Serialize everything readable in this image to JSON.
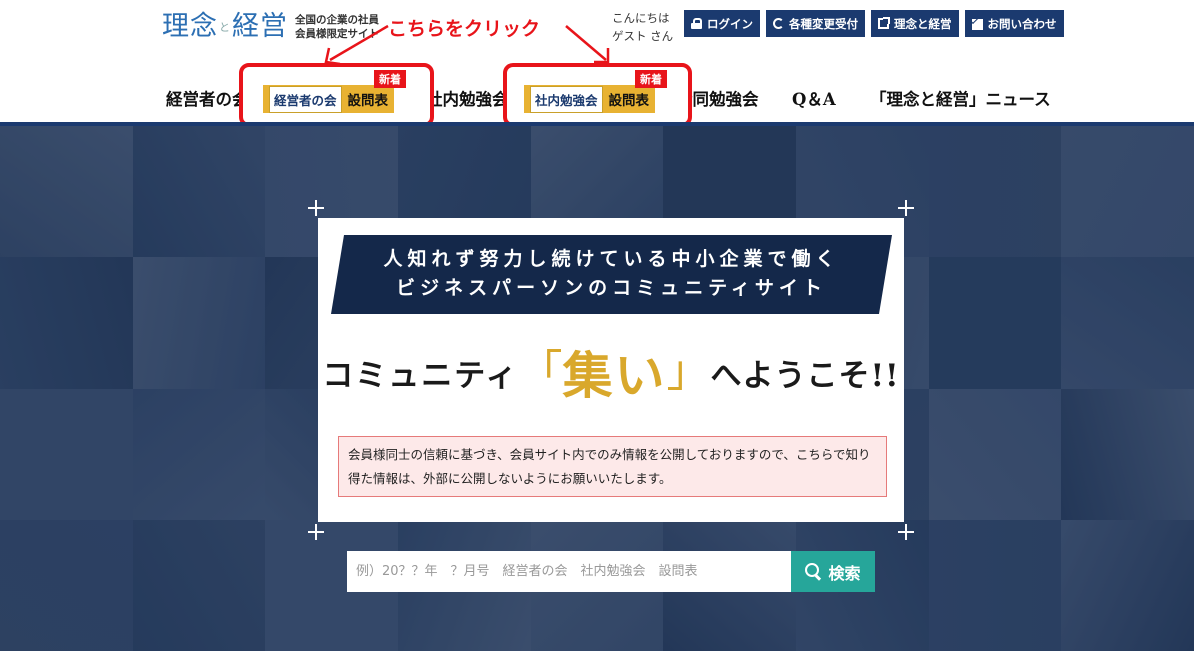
{
  "header": {
    "logo_text": "理念",
    "logo_connector": "と",
    "logo_text2": "経営",
    "logo_sub_line1": "全国の企業の社員",
    "logo_sub_line2": "会員様限定サイト",
    "greeting_line1": "こんにちは",
    "greeting_line2": "ゲスト さん",
    "buttons": [
      {
        "label": "ログイン",
        "icon": "lock-icon"
      },
      {
        "label": "各種変更受付",
        "icon": "sync-icon"
      },
      {
        "label": "理念と経営",
        "icon": "external-link-icon"
      },
      {
        "label": "お問い合わせ",
        "icon": "mail-icon"
      }
    ]
  },
  "annotation": {
    "text": "こちらをクリック",
    "color": "#e8141a"
  },
  "nav": {
    "items": [
      {
        "label": "経営者の会"
      },
      {
        "label": "社内勉強会"
      },
      {
        "label": "合同勉強会"
      },
      {
        "label": "Q＆A"
      },
      {
        "label": "「理念と経営」ニュース"
      }
    ],
    "highlight_1": {
      "chip_label": "経営者の会",
      "chip_text": "設問表",
      "badge": "新着"
    },
    "highlight_2": {
      "chip_label": "社内勉強会",
      "chip_text": "設問表",
      "badge": "新着"
    }
  },
  "hero": {
    "banner_line1": "人知れず努力し続けている中小企業で働く",
    "banner_line2": "ビジネスパーソンのコミュニティサイト",
    "welcome_pre": "コミュニティ",
    "bracket_open": "「",
    "welcome_big": "集い",
    "bracket_close": "」",
    "welcome_suf": "へようこそ!!",
    "notice_text": "会員様同士の信頼に基づき、会員サイト内でのみ情報を公開しておりますので、こちらで知り得た情報は、外部に公開しないようにお願いいたします。"
  },
  "search": {
    "placeholder": "例）20？？年　？月号　経営者の会　社内勉強会　設問表",
    "button_label": "検索"
  },
  "colors": {
    "brand_navy": "#1b3a6f",
    "accent_gold": "#d9a82c",
    "search_teal": "#26a69a",
    "highlight_red": "#e8141a"
  }
}
